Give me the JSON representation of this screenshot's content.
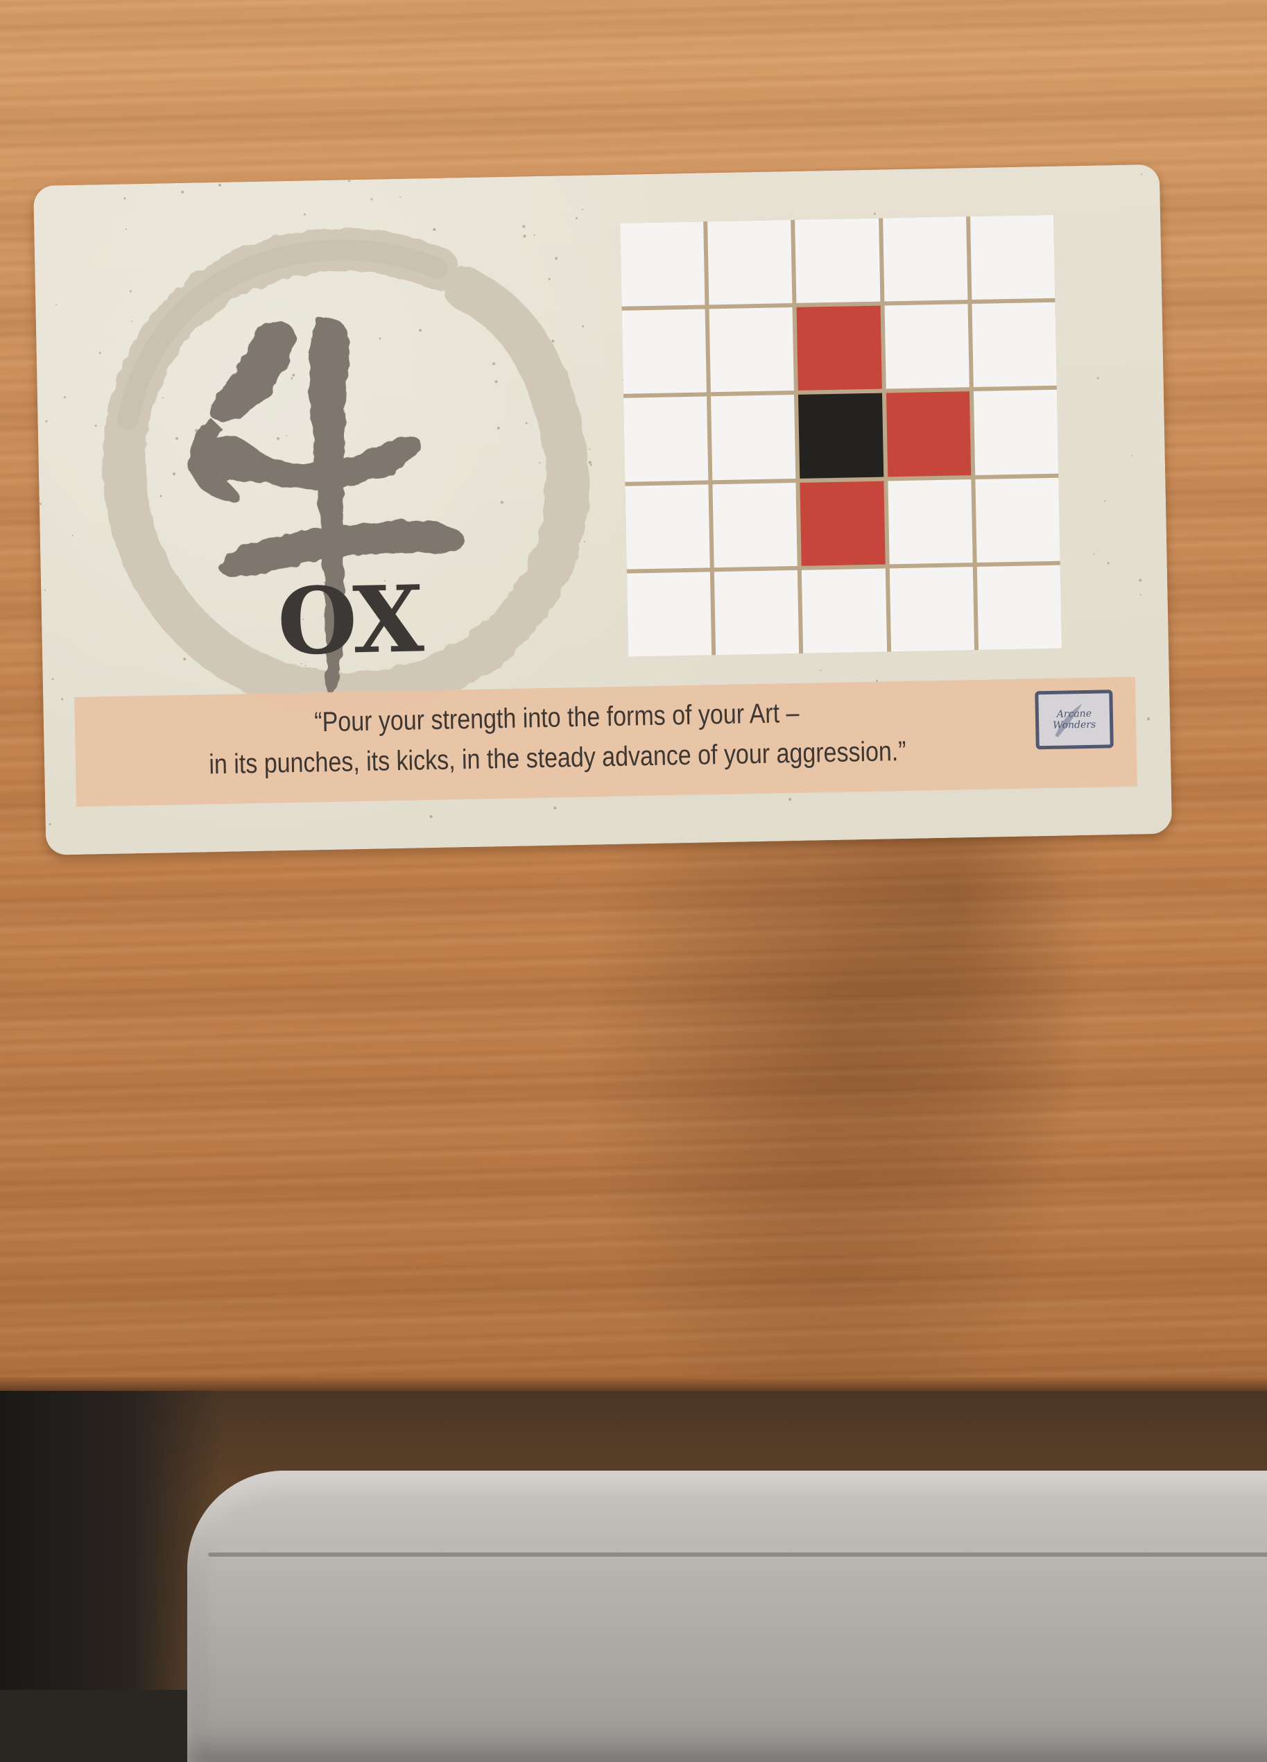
{
  "card": {
    "title": "OX",
    "character": "牛",
    "quote_line_1": "“Pour your strength into the forms of your Art –",
    "quote_line_2": "in its punches, its kicks, in the steady advance of your aggression.”",
    "logo_line_1": "Arcane",
    "logo_line_2": "Wonders"
  },
  "move_grid": {
    "rows": 5,
    "cols": 5,
    "cells": [
      [
        "empty",
        "empty",
        "empty",
        "empty",
        "empty"
      ],
      [
        "empty",
        "empty",
        "red",
        "empty",
        "empty"
      ],
      [
        "empty",
        "empty",
        "black",
        "red",
        "empty"
      ],
      [
        "empty",
        "empty",
        "red",
        "empty",
        "empty"
      ],
      [
        "empty",
        "empty",
        "empty",
        "empty",
        "empty"
      ]
    ]
  },
  "colors": {
    "move_square": "#c6463c",
    "origin_square": "#242221",
    "quote_band": "#e9c3a4",
    "table_wood": "#cf8e58"
  }
}
